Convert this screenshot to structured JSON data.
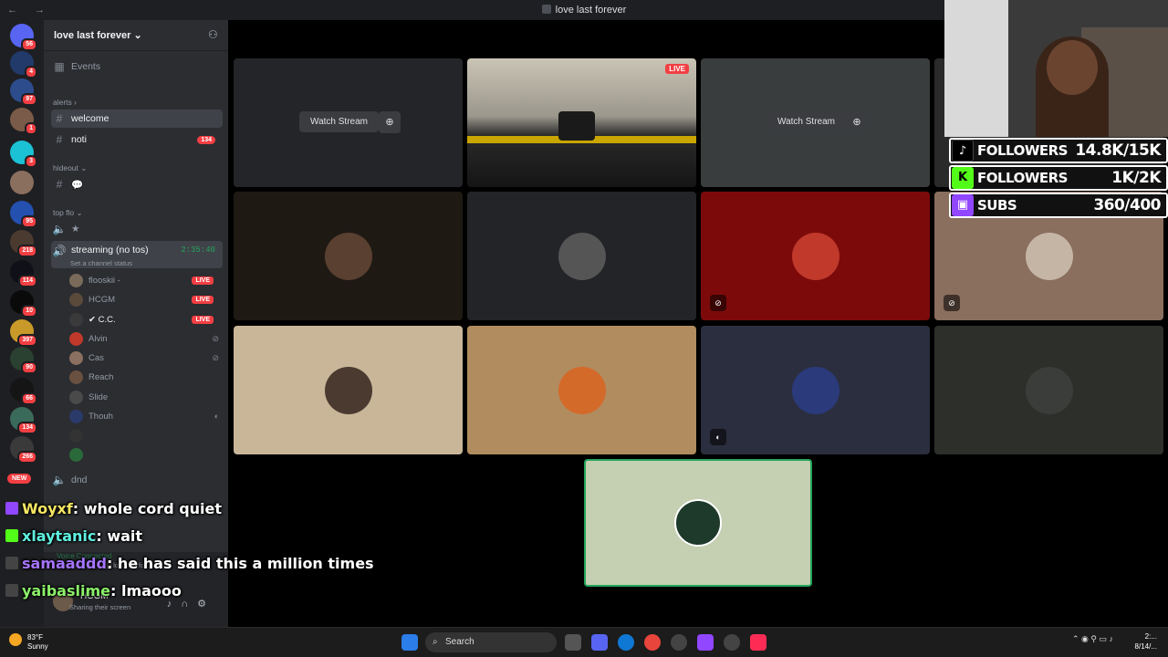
{
  "window": {
    "title": "love last forever",
    "nav": "← →"
  },
  "server_list": {
    "badges": [
      "56",
      "4",
      "97",
      "1",
      "3",
      "",
      "95",
      "218",
      "114",
      "10",
      "397",
      "90",
      "66",
      "134",
      "266"
    ],
    "new_label": "NEW"
  },
  "channel_panel": {
    "server_name": "love last forever",
    "events_label": "Events",
    "categories": {
      "alerts": "alerts",
      "hideout": "hideout",
      "top_flo": "top flo"
    },
    "channels": {
      "welcome": "welcome",
      "noti": "noti",
      "noti_badge": "134",
      "bubble": "💬",
      "star": "★",
      "streaming": "streaming (no tos)",
      "streaming_timer": "2:35:40",
      "streaming_status": "Set a channel status",
      "dnd": "dnd"
    },
    "voice_users": [
      {
        "name": "flooskii -",
        "live": "LIVE"
      },
      {
        "name": "HCGM",
        "live": "LIVE"
      },
      {
        "name": "✔ C.C.",
        "live": "LIVE"
      },
      {
        "name": "Alvin"
      },
      {
        "name": "Cas"
      },
      {
        "name": "Reach"
      },
      {
        "name": "Slide"
      },
      {
        "name": "Thouh"
      }
    ]
  },
  "user_panel": {
    "voice_connected": "Voice Connected",
    "voice_channel": "streaming (no tos) / love last forever",
    "username": "HCGM",
    "status": "Sharing their screen"
  },
  "stage": {
    "watch_stream_label": "Watch Stream",
    "live_label": "LIVE"
  },
  "overlay": {
    "goals": [
      {
        "label": "FOLLOWERS",
        "value": "14.8K/15K",
        "icon": "tiktok-icon",
        "color": "#000000"
      },
      {
        "label": "FOLLOWERS",
        "value": "1K/2K",
        "icon": "kick-icon",
        "color": "#53fc18"
      },
      {
        "label": "SUBS",
        "value": "360/400",
        "icon": "twitch-icon",
        "color": "#9146ff"
      }
    ],
    "chat": [
      {
        "user": "Woyxf",
        "msg": "whole cord quiet",
        "color": "#f5e663"
      },
      {
        "user": "xlaytanic",
        "msg": "wait",
        "color": "#5ff0e0"
      },
      {
        "user": "samaaddd",
        "msg": "he has said this a million times",
        "color": "#a574ff"
      },
      {
        "user": "yaibaslime",
        "msg": "lmaooo",
        "color": "#8bf06a"
      }
    ]
  },
  "taskbar": {
    "temp": "83°F",
    "weather": "Sunny",
    "search_placeholder": "Search",
    "clock_time": "2:...",
    "clock_date": "8/14/..."
  }
}
